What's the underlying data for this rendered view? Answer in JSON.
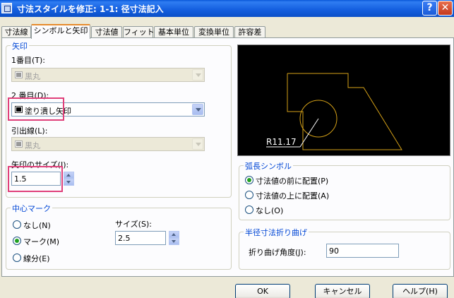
{
  "window": {
    "title": "寸法スタイルを修正: 1-1: 径寸法記入",
    "help_label": "?",
    "close_label": "✕"
  },
  "tabs": [
    {
      "label": "寸法線"
    },
    {
      "label": "シンボルと矢印"
    },
    {
      "label": "寸法値"
    },
    {
      "label": "フィット"
    },
    {
      "label": "基本単位"
    },
    {
      "label": "変換単位"
    },
    {
      "label": "許容差"
    }
  ],
  "arrowheads": {
    "title": "矢印",
    "first_label": "1番目(T):",
    "first_value": "黒丸",
    "second_label": "2 番目(D):",
    "second_value": "塗り潰し矢印",
    "leader_label": "引出線(L):",
    "leader_value": "黒丸",
    "size_label": "矢印のサイズ(I):",
    "size_value": "1.5"
  },
  "center_mark": {
    "title": "中心マーク",
    "options": [
      "なし(N)",
      "マーク(M)",
      "線分(E)"
    ],
    "selected": "マーク(M)",
    "size_label": "サイズ(S):",
    "size_value": "2.5"
  },
  "preview": {
    "dimension_text": "R11.17"
  },
  "arc_length": {
    "title": "弧長シンボル",
    "options": [
      "寸法値の前に配置(P)",
      "寸法値の上に配置(A)",
      "なし(O)"
    ],
    "selected": "寸法値の前に配置(P)"
  },
  "radius_jog": {
    "title": "半径寸法折り曲げ",
    "angle_label": "折り曲げ角度(J):",
    "angle_value": "90"
  },
  "buttons": {
    "ok": "OK",
    "cancel": "キャンセル",
    "help": "ヘルプ(H)"
  },
  "colors": {
    "title_bar": "#0b4fc7",
    "group_title": "#0046d5",
    "highlight": "#e0407a",
    "preview_geometry": "#d4a017",
    "preview_center_line": "#ffffff"
  }
}
